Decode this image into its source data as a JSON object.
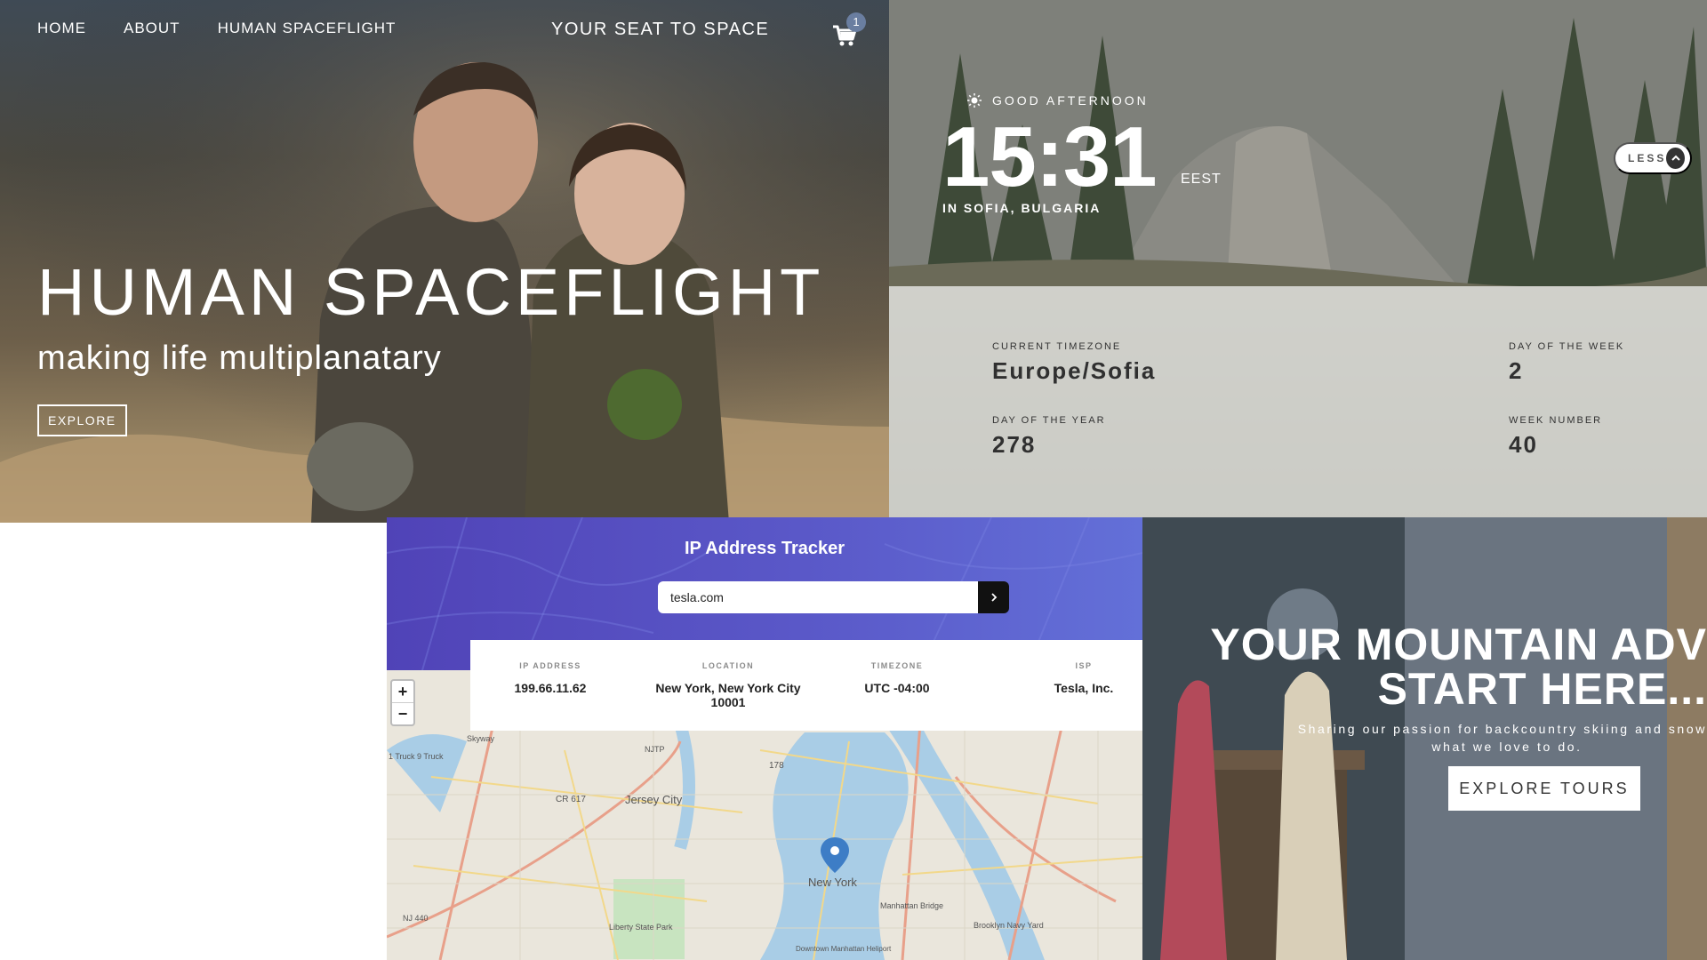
{
  "spaceflight": {
    "nav": [
      "HOME",
      "ABOUT",
      "HUMAN SPACEFLIGHT"
    ],
    "brand": "YOUR SEAT TO SPACE",
    "cart_count": "1",
    "heading": "HUMAN SPACEFLIGHT",
    "subheading": "making life multiplanatary",
    "cta": "EXPLORE"
  },
  "clock": {
    "greeting": "GOOD AFTERNOON",
    "time": "15:31",
    "zone_abbr": "EEST",
    "location": "IN SOFIA, BULGARIA",
    "toggle_label": "LESS",
    "details": [
      {
        "label": "CURRENT TIMEZONE",
        "value": "Europe/Sofia"
      },
      {
        "label": "DAY OF THE WEEK",
        "value": "2"
      },
      {
        "label": "DAY OF THE YEAR",
        "value": "278"
      },
      {
        "label": "WEEK NUMBER",
        "value": "40"
      }
    ]
  },
  "ip_tracker": {
    "title": "IP Address Tracker",
    "search_value": "tesla.com",
    "results": [
      {
        "label": "IP ADDRESS",
        "value": "199.66.11.62"
      },
      {
        "label": "LOCATION",
        "value": "New York, New York City 10001"
      },
      {
        "label": "TIMEZONE",
        "value": "UTC -04:00"
      },
      {
        "label": "ISP",
        "value": "Tesla, Inc."
      }
    ],
    "zoom_in": "+",
    "zoom_out": "−",
    "map_labels": {
      "jersey_city": "Jersey City",
      "new_york": "New York",
      "cr617": "CR 617",
      "r178": "178",
      "njtp": "NJTP",
      "manhattan_bridge": "Manhattan Bridge",
      "liberty_park": "Liberty State Park",
      "brooklyn": "Brooklyn Navy Yard",
      "skyway": "Skyway",
      "truck": "1 Truck 9 Truck",
      "nj440": "NJ 440",
      "downtown": "Downtown Manhattan Heliport"
    },
    "pin_color": "#3d7dc6"
  },
  "mountain": {
    "headline_1": "YOUR MOUNTAIN ADV",
    "headline_2": "START HERE...",
    "line_1": "Sharing our passion for backcountry skiing and snowb",
    "line_2": "what we love to do.",
    "cta": "EXPLORE TOURS"
  }
}
